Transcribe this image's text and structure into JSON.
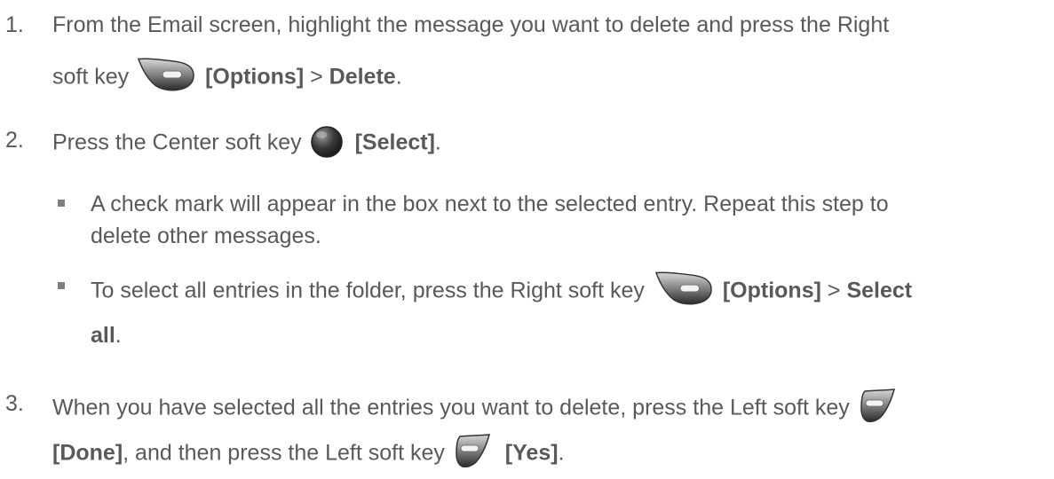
{
  "steps": [
    {
      "number": "1.",
      "line1": "From the Email screen, highlight the message you want to delete and press the Right",
      "line2_pre": "soft key",
      "line2_key_label": "[Options]",
      "line2_sep": " > ",
      "line2_action": "Delete",
      "line2_end": ".",
      "icon": "right-soft-key-icon"
    },
    {
      "number": "2.",
      "pre": "Press the Center soft key",
      "key_label": "[Select]",
      "end": ".",
      "icon": "center-soft-key-icon",
      "bullets": [
        {
          "line1": "A check mark will appear in the box next to the selected entry. Repeat this step to",
          "line2": "delete other messages."
        },
        {
          "line1_pre": "To select all entries in the folder, press the Right soft key",
          "key_label": "[Options]",
          "sep": " > ",
          "action_part1": "Select",
          "action_part2": "all",
          "end": ".",
          "icon": "right-soft-key-icon"
        }
      ]
    },
    {
      "number": "3.",
      "line1": "When you have selected all the entries you want to delete, press the Left soft key",
      "line2_label1": "[Done]",
      "line2_mid": ", and then press the Left soft key",
      "line2_label2": "[Yes]",
      "line2_end": ".",
      "icon": "left-soft-key-icon"
    }
  ]
}
